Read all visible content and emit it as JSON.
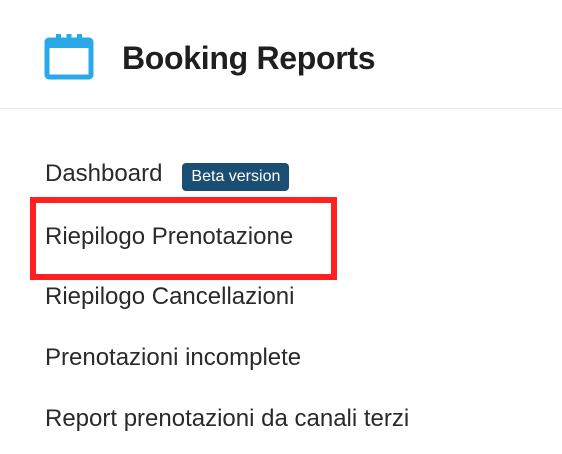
{
  "header": {
    "title": "Booking Reports",
    "icon": "calendar-icon",
    "icon_color": "#2aa8e8"
  },
  "menu": {
    "items": [
      {
        "label": "Dashboard",
        "badge": "Beta version"
      },
      {
        "label": "Riepilogo Prenotazione"
      },
      {
        "label": "Riepilogo Cancellazioni"
      },
      {
        "label": "Prenotazioni incomplete"
      },
      {
        "label": "Report prenotazioni da canali terzi"
      }
    ]
  },
  "colors": {
    "badge_bg": "#1a4f73",
    "highlight": "#ff2020"
  }
}
